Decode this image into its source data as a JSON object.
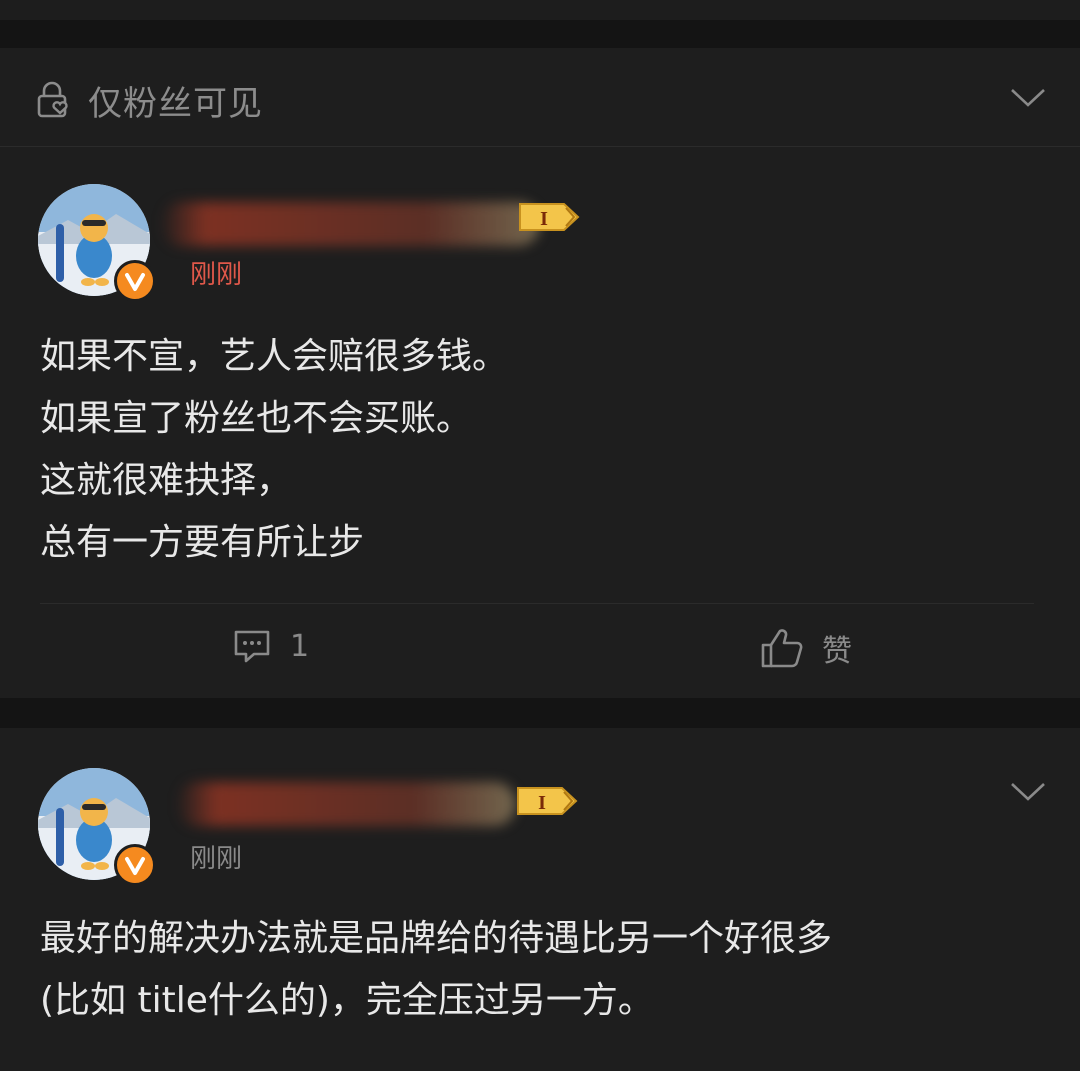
{
  "visibility": {
    "label": "仅粉丝可见",
    "icon": "lock-heart-icon",
    "expand_icon": "chevron-down-icon"
  },
  "posts": [
    {
      "time": "刚刚",
      "lines": [
        "如果不宣，艺人会赔很多钱。",
        "如果宣了粉丝也不会买账。",
        "这就很难抉择，",
        "总有一方要有所让步"
      ],
      "comment_count": "1",
      "like_label": "赞"
    },
    {
      "time": "刚刚",
      "lines": [
        "最好的解决办法就是品牌给的待遇比另一个好很多",
        "(比如 title什么的)，完全压过另一方。"
      ]
    }
  ],
  "badges": {
    "level_text": "I",
    "verified_text": "V"
  },
  "colors": {
    "time_post1": "#e0584a",
    "time_post2": "#8a8a8a",
    "badge_gold": "#f3c54a",
    "verified_orange": "#f58a1f"
  }
}
